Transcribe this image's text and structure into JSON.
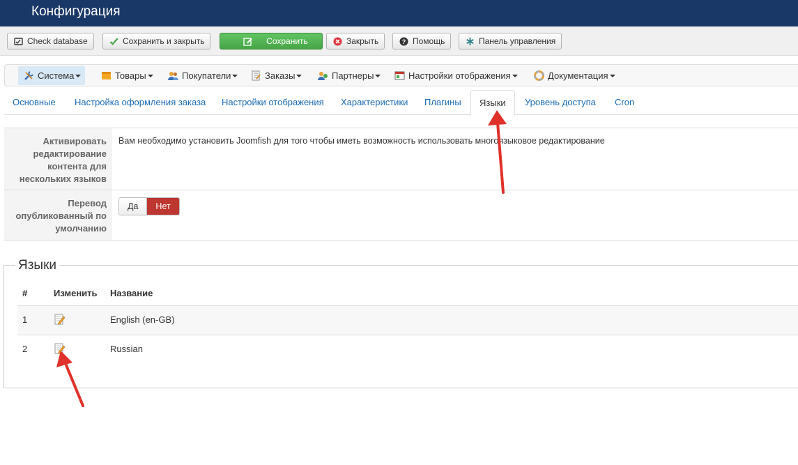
{
  "header": {
    "title": "Конфигурация"
  },
  "toolbar": {
    "check_db": "Check database",
    "save_close": "Сохранить и закрыть",
    "save": "Сохранить",
    "close": "Закрыть",
    "help": "Помощь",
    "panel": "Панель управления"
  },
  "menu": {
    "items": [
      {
        "label": "Система"
      },
      {
        "label": "Товары"
      },
      {
        "label": "Покупатели"
      },
      {
        "label": "Заказы"
      },
      {
        "label": "Партнеры"
      },
      {
        "label": "Настройки отображения"
      },
      {
        "label": "Документация"
      }
    ]
  },
  "tabs": [
    {
      "label": "Основные"
    },
    {
      "label": "Настройка оформления заказа"
    },
    {
      "label": "Настройки отображения"
    },
    {
      "label": "Характеристики"
    },
    {
      "label": "Плагины"
    },
    {
      "label": "Языки"
    },
    {
      "label": "Уровень доступа"
    },
    {
      "label": "Cron"
    }
  ],
  "form": {
    "multilang_label": "Активировать редактирование контента для нескольких языков",
    "multilang_value": "Вам необходимо установить Joomfish для того чтобы иметь возможность использовать многоязыковое редактирование",
    "translate_label": "Перевод опубликованный по умолчанию",
    "toggle_yes": "Да",
    "toggle_no": "Нет"
  },
  "languages": {
    "legend": "Языки",
    "col_num": "#",
    "col_edit": "Изменить",
    "col_name": "Название",
    "rows": [
      {
        "num": "1",
        "name": "English (en-GB)"
      },
      {
        "num": "2",
        "name": "Russian"
      }
    ]
  },
  "colors": {
    "header_bg": "#1a3867",
    "save_green": "#46a546",
    "toggle_no_red": "#bd362f",
    "link_blue": "#1a6bb3",
    "annotation_arrow": "#e0312a"
  }
}
